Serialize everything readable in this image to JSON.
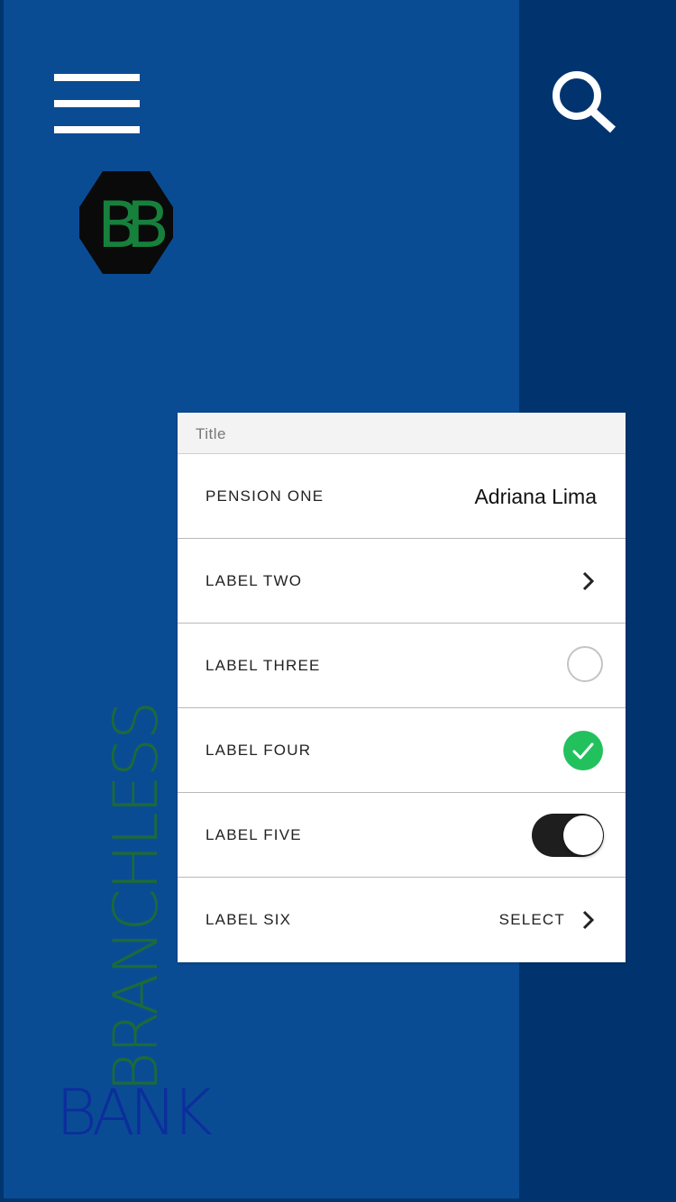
{
  "brand": {
    "logo_letters": "BB",
    "name_vertical": "BRANCHLESS",
    "name_horizontal": "BANK"
  },
  "header": {
    "menu_icon": "hamburger-menu-icon",
    "search_icon": "search-icon"
  },
  "card": {
    "title": "Title",
    "rows": [
      {
        "label": "PENSION ONE",
        "value": "Adriana Lima",
        "accessory": "text"
      },
      {
        "label": "LABEL TWO",
        "accessory": "chevron-right-icon"
      },
      {
        "label": "LABEL THREE",
        "accessory": "radio-unchecked"
      },
      {
        "label": "LABEL FOUR",
        "accessory": "check-circle-icon"
      },
      {
        "label": "LABEL FIVE",
        "accessory": "toggle",
        "toggle_on": true
      },
      {
        "label": "LABEL SIX",
        "value": "SELECT",
        "accessory": "chevron-right-icon"
      }
    ]
  },
  "colors": {
    "panel_blue": "#0a4c94",
    "navy": "#01346f",
    "check_green": "#22c15e",
    "brand_green": "#1d6a3a",
    "brand_blue": "#0c2e9c"
  }
}
